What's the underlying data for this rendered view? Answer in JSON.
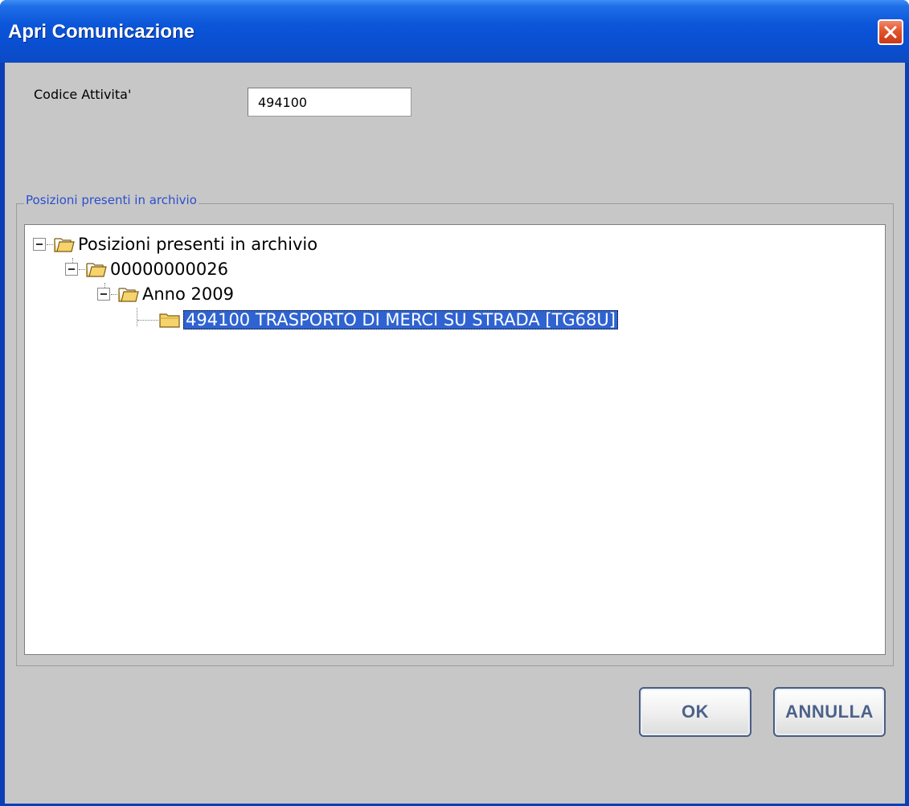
{
  "window": {
    "title": "Apri Comunicazione",
    "close_icon": "close-icon"
  },
  "form": {
    "codice_label": "Codice Attivita'",
    "codice_value": "494100"
  },
  "group": {
    "legend": "Posizioni presenti in archivio"
  },
  "tree": {
    "nodes": [
      {
        "label": "Posizioni presenti in archivio",
        "level": 0,
        "expanded": true,
        "icon": "folder-open-icon"
      },
      {
        "label": "00000000026",
        "level": 1,
        "expanded": true,
        "icon": "folder-open-icon"
      },
      {
        "label": "Anno 2009",
        "level": 2,
        "expanded": true,
        "icon": "folder-open-icon"
      },
      {
        "label": "494100 TRASPORTO DI MERCI SU STRADA [TG68U]",
        "level": 3,
        "selected": true,
        "icon": "folder-closed-icon"
      }
    ]
  },
  "buttons": {
    "ok": "OK",
    "cancel": "ANNULLA"
  },
  "colors": {
    "titlebar": "#0b55d8",
    "selection": "#2f63d1",
    "legend_text": "#2b4fce",
    "dialog_bg": "#c7c7c7"
  }
}
